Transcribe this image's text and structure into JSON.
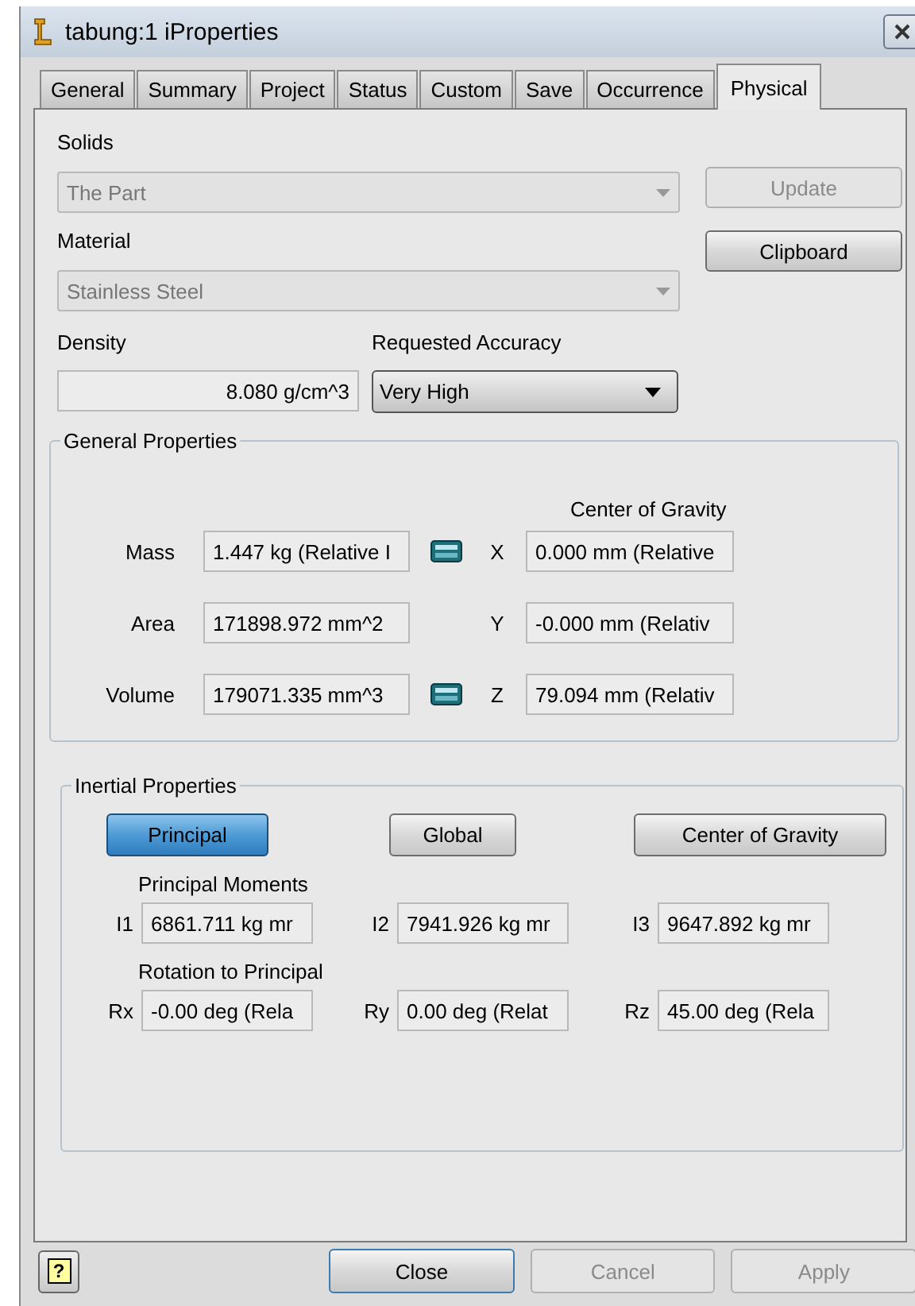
{
  "window": {
    "title": "tabung:1 iProperties"
  },
  "tabs": [
    {
      "label": "General",
      "selected": false
    },
    {
      "label": "Summary",
      "selected": false
    },
    {
      "label": "Project",
      "selected": false
    },
    {
      "label": "Status",
      "selected": false
    },
    {
      "label": "Custom",
      "selected": false
    },
    {
      "label": "Save",
      "selected": false
    },
    {
      "label": "Occurrence",
      "selected": false
    },
    {
      "label": "Physical",
      "selected": true
    }
  ],
  "solids": {
    "label": "Solids",
    "value": "The Part",
    "disabled": true
  },
  "material": {
    "label": "Material",
    "value": "Stainless Steel",
    "disabled": true
  },
  "side_buttons": [
    {
      "label": "Update",
      "disabled": true
    },
    {
      "label": "Clipboard",
      "disabled": false
    }
  ],
  "density": {
    "label": "Density",
    "value": "8.080 g/cm^3"
  },
  "accuracy": {
    "label": "Requested Accuracy",
    "value": "Very High"
  },
  "general_properties": {
    "title": "General Properties",
    "center_of_gravity_label": "Center of Gravity",
    "rows": [
      {
        "label": "Mass",
        "value": "1.447 kg (Relative I",
        "calculator": true,
        "axis": "X",
        "axis_value": "0.000 mm (Relative"
      },
      {
        "label": "Area",
        "value": "171898.972 mm^2",
        "calculator": false,
        "axis": "Y",
        "axis_value": "-0.000 mm (Relativ"
      },
      {
        "label": "Volume",
        "value": "179071.335 mm^3",
        "calculator": true,
        "axis": "Z",
        "axis_value": "79.094 mm (Relativ"
      }
    ]
  },
  "inertial_properties": {
    "title": "Inertial Properties",
    "views": [
      {
        "label": "Principal",
        "selected": true
      },
      {
        "label": "Global",
        "selected": false
      },
      {
        "label": "Center of Gravity",
        "selected": false
      }
    ],
    "moments_label": "Principal Moments",
    "moments": [
      {
        "label": "I1",
        "value": "6861.711 kg mr"
      },
      {
        "label": "I2",
        "value": "7941.926 kg mr"
      },
      {
        "label": "I3",
        "value": "9647.892 kg mr"
      }
    ],
    "rotation_label": "Rotation to Principal",
    "rotations": [
      {
        "label": "Rx",
        "value": "-0.00 deg (Rela"
      },
      {
        "label": "Ry",
        "value": "0.00 deg (Relat"
      },
      {
        "label": "Rz",
        "value": "45.00 deg (Rela"
      }
    ]
  },
  "help_button": "?",
  "footer_buttons": [
    {
      "label": "Close",
      "disabled": false,
      "default": true
    },
    {
      "label": "Cancel",
      "disabled": true,
      "default": false
    },
    {
      "label": "Apply",
      "disabled": true,
      "default": false
    }
  ]
}
